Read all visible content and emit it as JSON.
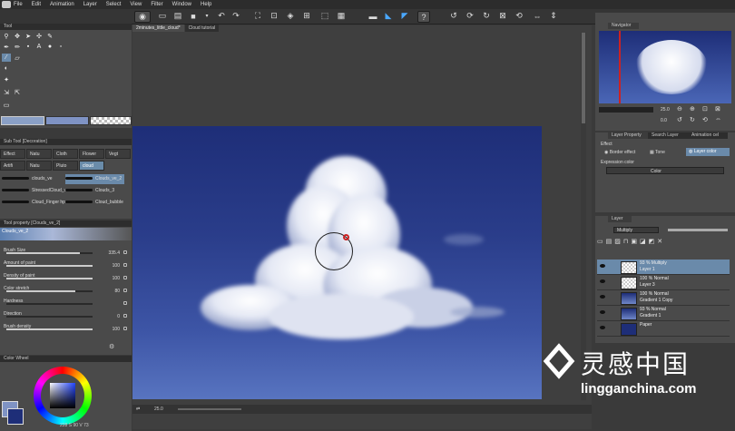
{
  "menubar": {
    "items": [
      "File",
      "Edit",
      "Animation",
      "Layer",
      "Select",
      "View",
      "Filter",
      "Window",
      "Help"
    ]
  },
  "tool_panel": {
    "title": "Tool"
  },
  "sub_tool_panel": {
    "title": "Sub Tool [Decoration]",
    "tabs_row1": [
      "Effect",
      "Natu",
      "Cloth",
      "Flower",
      "Vegt"
    ],
    "tabs_row2": [
      "Artifi",
      "Natu",
      "Pluto",
      "cloud"
    ],
    "brushes": [
      {
        "name": "clouds_ve"
      },
      {
        "name": "Clouds_ve_2"
      },
      {
        "name": "StressedCloud_ve"
      },
      {
        "name": "Clouds_3"
      },
      {
        "name": "Cloud_Finger hp"
      },
      {
        "name": "Cloud_bubble"
      }
    ]
  },
  "tool_property": {
    "title": "Tool property [Clouds_ve_2]",
    "tool_name": "Clouds_ve_2",
    "rows": [
      {
        "label": "Brush Size",
        "value": "335.4",
        "fill": 0.85
      },
      {
        "label": "Amount of paint",
        "value": "100",
        "fill": 1.0
      },
      {
        "label": "Density of paint",
        "value": "100",
        "fill": 1.0
      },
      {
        "label": "Color stretch",
        "value": "80",
        "fill": 0.8
      },
      {
        "label": "Hardness",
        "value": "",
        "fill": 0
      },
      {
        "label": "Direction",
        "value": "0",
        "fill": 0.0
      },
      {
        "label": "Brush density",
        "value": "100",
        "fill": 1.0
      }
    ]
  },
  "color_wheel": {
    "title": "Color Wheel",
    "readout": "228 S 90 V 73",
    "main_color": "#1e2e78",
    "sub_color": "#7f93c4"
  },
  "document": {
    "tabs": [
      "2minutes_little_cloud*",
      "Cloud tutorial"
    ],
    "status_zoom": "25.0"
  },
  "navigator": {
    "title": "Navigator",
    "zoom": "25.0",
    "angle": "0.0"
  },
  "layer_property": {
    "title": "Layer Property",
    "tabs": [
      "Layer Property",
      "Search Layer",
      "Animation cel"
    ],
    "effect_label": "Effect",
    "effects": [
      "Border effect",
      "Tone",
      "Layer color"
    ],
    "expression_label": "Expression color",
    "expression_value": "Color"
  },
  "layer_panel": {
    "title": "Layer",
    "blend_mode": "Multiply",
    "layers": [
      {
        "line1": "93 % Multiply",
        "line2": "Layer 1",
        "selected": true,
        "thumb": "checker"
      },
      {
        "line1": "100 % Normal",
        "line2": "Layer 3",
        "selected": false,
        "thumb": "checker"
      },
      {
        "line1": "100 % Normal",
        "line2": "Gradient 1 Copy",
        "selected": false,
        "thumb": "gradient"
      },
      {
        "line1": "93 % Normal",
        "line2": "Gradient 1",
        "selected": false,
        "thumb": "gradient"
      },
      {
        "line1": "Paper",
        "line2": "",
        "selected": false,
        "thumb": "blue"
      }
    ]
  },
  "watermark": {
    "chinese": "灵感中国",
    "url": "lingganchina.com"
  }
}
